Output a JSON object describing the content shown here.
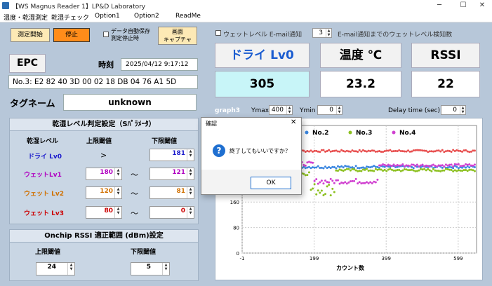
{
  "window": {
    "title": "【WS Magnus Reader 1】LP&D Laboratory"
  },
  "menu": [
    "温度・乾湿測定",
    "乾湿チェック",
    "Option1",
    "Option2",
    "ReadMe"
  ],
  "controls": {
    "start": "測定開始",
    "stop": "停止",
    "auto_save": "データ自動保存\n測定停止時",
    "screen_capture": "画面\nキャプチャ"
  },
  "epc": {
    "label": "EPC",
    "time_label": "時刻",
    "time_value": "2025/04/12 9:17:12",
    "epc_value": "No.3:  E2 82 40 3D 00 02 18 DB 04 76 A1 5D"
  },
  "tag": {
    "label": "タグネーム",
    "value": "unknown"
  },
  "wet": {
    "title": "乾湿レベル判定設定（Sﾊﾟﾗﾒｰﾀ）",
    "col_level": "乾湿レベル",
    "col_upper": "上限閾値",
    "col_lower": "下限閾値",
    "rows": [
      {
        "name": "ドライ Lv0",
        "upper": ">",
        "lower": "181",
        "color": "#1a1acc"
      },
      {
        "name": "ウェットLv1",
        "upper": "180",
        "tilde": "〜",
        "lower": "121",
        "color": "#b000c0"
      },
      {
        "name": "ウェット Lv2",
        "upper": "120",
        "tilde": "〜",
        "lower": "81",
        "color": "#d07000"
      },
      {
        "name": "ウェット Lv3",
        "upper": "80",
        "tilde": "〜",
        "lower": "0",
        "color": "#cc0000"
      }
    ]
  },
  "rssi_range": {
    "title": "Onchip RSSI 適正範囲 (dBm)設定",
    "upper_label": "上限閾値",
    "lower_label": "下限閾値",
    "upper": "24",
    "lower": "5"
  },
  "email": {
    "label": "ウェットレベル E-mail通知",
    "count": "3",
    "count_label": "E-mail通知までのウェットレベル検知数"
  },
  "status": {
    "level": "ドライ Lv0",
    "temp_label": "温度 ℃",
    "rssi_label": "RSSI",
    "level_value": "305",
    "temp_value": "23.2",
    "rssi_value": "22"
  },
  "graph": {
    "title": "graph3",
    "ymax_label": "Ymax",
    "ymax": "400",
    "ymin_label": "Ymin",
    "ymin": "0",
    "delay_label": "Delay time (sec)",
    "delay": "0",
    "xlabel": "カウント数"
  },
  "chart_data": {
    "type": "scatter",
    "xlabel": "カウント数",
    "x_ticks": [
      "-1",
      "199",
      "399",
      "599"
    ],
    "y_ticks": [
      "160",
      "80",
      "0"
    ],
    "xlim": [
      -1,
      650
    ],
    "ylim": [
      0,
      400
    ],
    "series": [
      {
        "name": "No.2",
        "color": "#3a86e0"
      },
      {
        "name": "No.3",
        "color": "#8cc020"
      },
      {
        "name": "No.4",
        "color": "#d040d0"
      }
    ]
  },
  "dialog": {
    "title": "確認",
    "message": "終了してもいいですか？",
    "ok": "OK"
  }
}
